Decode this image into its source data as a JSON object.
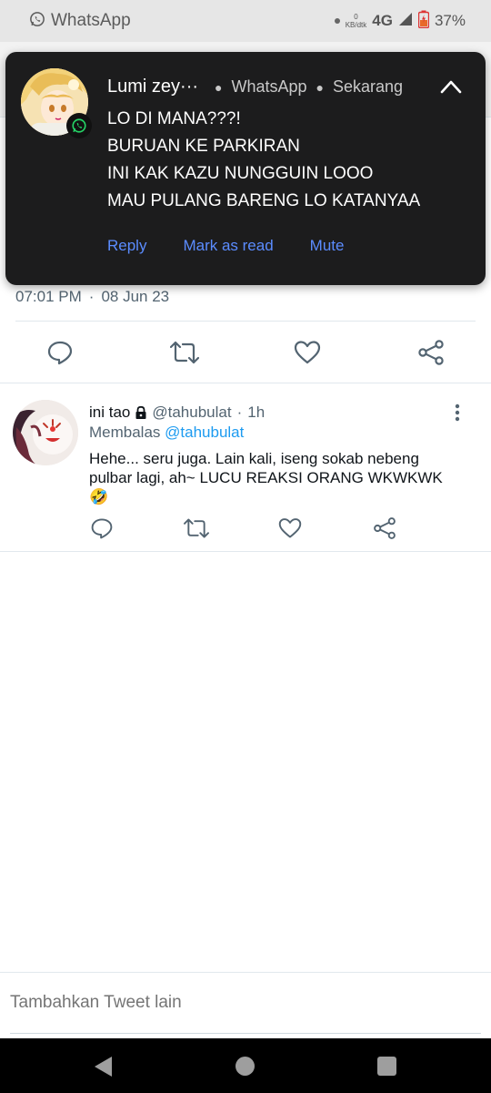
{
  "status_bar": {
    "app_title": "WhatsApp",
    "speed_value": "0",
    "speed_unit": "KB/dtk",
    "network": "4G",
    "battery": "37%"
  },
  "notification": {
    "sender": "Lumi zey···",
    "app": "WhatsApp",
    "time": "Sekarang",
    "lines": [
      "LO DI MANA???!",
      "BURUAN KE PARKIRAN",
      "INI KAK KAZU NUNGGUIN LOOO",
      "MAU PULANG BARENG LO KATANYAA"
    ],
    "actions": [
      "Reply",
      "Mark as read",
      "Mute"
    ],
    "action_color": "#5b8cff"
  },
  "main_tweet": {
    "time": "07:01 PM",
    "date": "08 Jun 23"
  },
  "reply_tweet": {
    "name": "ini tao",
    "handle": "@tahubulat",
    "age": "1h",
    "replying_prefix": "Membalas",
    "replying_to": "@tahubulat",
    "text": "Hehe... seru juga. Lain kali, iseng sokab nebeng pulbar lagi, ah~ LUCU REAKSI ORANG WKWKWK 🤣"
  },
  "compose": {
    "placeholder": "Tambahkan Tweet lain"
  },
  "colors": {
    "accent": "#1d9bf0",
    "muted": "#536471",
    "icon": "#536471"
  }
}
